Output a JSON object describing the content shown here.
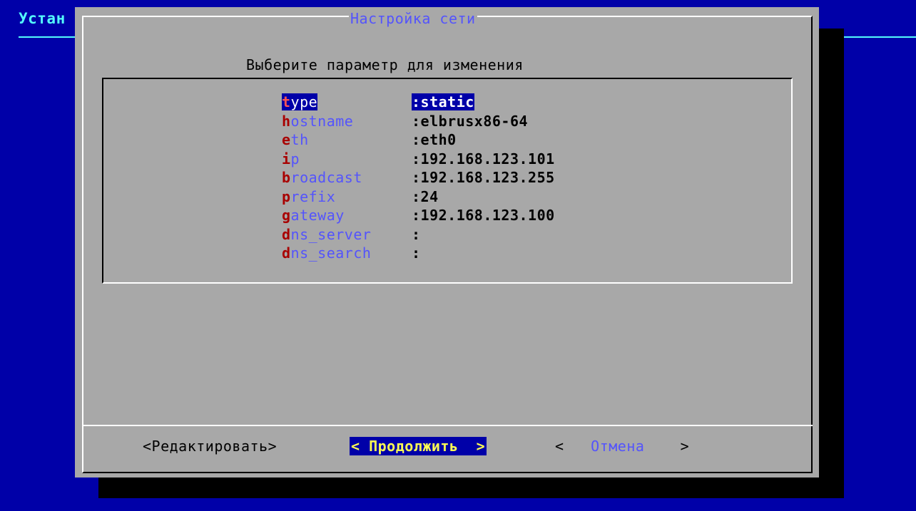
{
  "backtitle": "Устан",
  "dialog": {
    "title": "Настройка сети",
    "prompt": "Выберите параметр для изменения"
  },
  "menu": [
    {
      "hotkey": "t",
      "rest": "ype",
      "value": ":static",
      "selected": true
    },
    {
      "hotkey": "h",
      "rest": "ostname",
      "value": ":elbrusx86-64"
    },
    {
      "hotkey": "e",
      "rest": "th",
      "value": ":eth0"
    },
    {
      "hotkey": "i",
      "rest": "p",
      "value": ":192.168.123.101"
    },
    {
      "hotkey": "b",
      "rest": "roadcast",
      "value": ":192.168.123.255"
    },
    {
      "hotkey": "p",
      "rest": "refix",
      "value": ":24"
    },
    {
      "hotkey": "g",
      "rest": "ateway",
      "value": ":192.168.123.100"
    },
    {
      "hotkey": "d",
      "rest": "ns_server",
      "value": ":"
    },
    {
      "hotkey": "d",
      "rest": "ns_search",
      "value": ":"
    }
  ],
  "buttons": {
    "edit_open": "<",
    "edit": "Редактировать",
    "edit_close": ">",
    "continue_open": "< ",
    "continue": "Продолжить",
    "continue_close": "  >",
    "cancel_open": "<   ",
    "cancel": "Отмена",
    "cancel_close": "    >"
  },
  "colors": {
    "background": "#0000a8",
    "dialog": "#a8a8a8",
    "hotkey": "#a80000",
    "tag": "#5454fc",
    "selected_button_text": "#fcfc54"
  }
}
